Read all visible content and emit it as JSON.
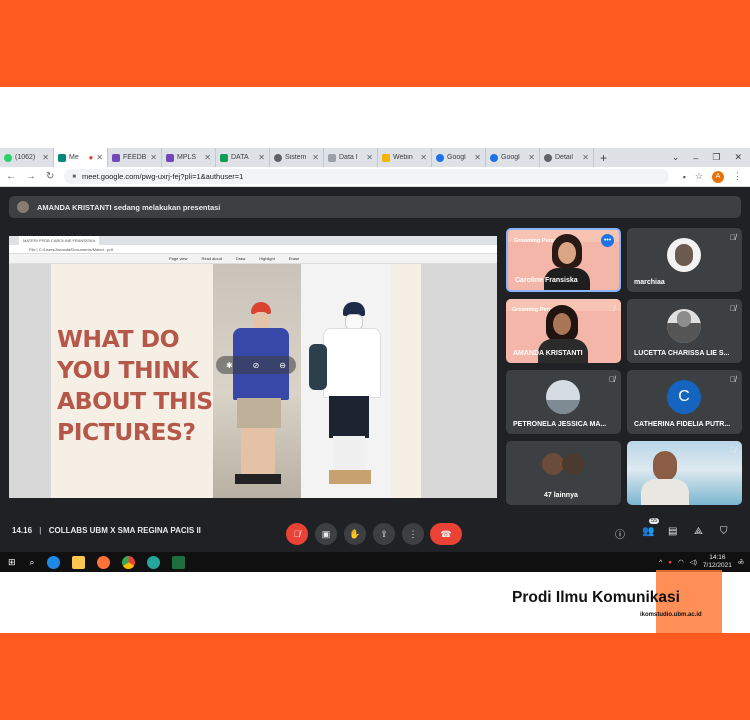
{
  "colors": {
    "orange_band": "#ff5a1f",
    "meet_dark": "#202124",
    "end_call": "#ea4335",
    "slide_text": "#b5584a"
  },
  "browser": {
    "tabs": [
      {
        "label": "(1062)",
        "icon": "whatsapp-icon",
        "color": "#25d366"
      },
      {
        "label": "Me",
        "icon": "meet-icon",
        "color": "#00897b",
        "active": true
      },
      {
        "label": "FEEDB",
        "icon": "forms-icon",
        "color": "#7248b9"
      },
      {
        "label": "MPLS",
        "icon": "forms-icon",
        "color": "#7248b9"
      },
      {
        "label": "DATA",
        "icon": "sheets-icon",
        "color": "#0f9d58"
      },
      {
        "label": "Sistem",
        "icon": "globe-icon",
        "color": "#5f6368"
      },
      {
        "label": "Data I",
        "icon": "page-icon",
        "color": "#9aa0a6"
      },
      {
        "label": "Webin",
        "icon": "slides-icon",
        "color": "#f4b400"
      },
      {
        "label": "Googl",
        "icon": "account-icon",
        "color": "#1a73e8"
      },
      {
        "label": "Googl",
        "icon": "account-icon",
        "color": "#1a73e8"
      },
      {
        "label": "Detail",
        "icon": "globe-icon",
        "color": "#5f6368"
      }
    ],
    "new_tab": "+",
    "url": "meet.google.com/pwg-uxrj-fej?pli=1&authuser=1",
    "profile_initial": "A"
  },
  "presenting_banner": "AMANDA KRISTANTI sedang melakukan presentasi",
  "shared_screen": {
    "pdf_tab": "MATERI PPDB CAROLINE FRANSISKA",
    "pdf_path": "File  |  C:/Users/Amanda/Documents/Materi...pdf",
    "pdf_tools": [
      "Page view",
      "Read aloud",
      "Draw",
      "Highlight",
      "Erase"
    ],
    "slide_text": "WHAT DO YOU THINK ABOUT THIS PICTURES?"
  },
  "participants": [
    {
      "name": "Caroline Fransiska",
      "banner": "Grooming Personal",
      "has_video": true
    },
    {
      "name": "marchiaa"
    },
    {
      "name": "AMANDA KRISTANTI",
      "banner": "Grooming Personal",
      "has_video": true
    },
    {
      "name": "LUCETTA CHARISSA LIE S..."
    },
    {
      "name": "PETRONELA JESSICA MA..."
    },
    {
      "name": "CATHERINA FIDELIA PUTR...",
      "initial": "C"
    },
    {
      "name": "47 lainnya"
    },
    {
      "name": "",
      "has_video": true
    }
  ],
  "meeting": {
    "time": "14.16",
    "separator": "|",
    "title": "COLLABS UBM X SMA REGINA PACIS II",
    "participant_count": "55"
  },
  "taskbar": {
    "time": "14:16",
    "date": "7/12/2021",
    "notification_count": "2"
  },
  "branding": {
    "title": "Prodi Ilmu Komunikasi",
    "url": "ikomstudio.ubm.ac.id"
  }
}
